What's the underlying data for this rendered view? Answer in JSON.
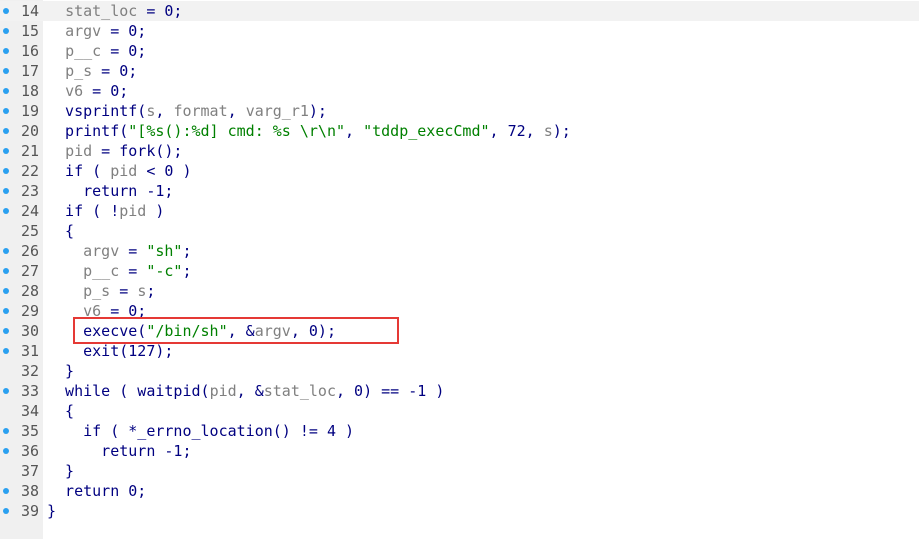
{
  "editor": {
    "accent_dot_color": "#2aa0f0",
    "highlight_color": "#e53935",
    "current_line": 14,
    "highlighted_line": 30
  },
  "lines": [
    {
      "num": "14",
      "dot": true,
      "tokens": [
        {
          "t": "  "
        },
        {
          "t": "stat_loc",
          "c": "var"
        },
        {
          "t": " = 0;"
        }
      ]
    },
    {
      "num": "15",
      "dot": true,
      "tokens": [
        {
          "t": "  "
        },
        {
          "t": "argv",
          "c": "var"
        },
        {
          "t": " = 0;"
        }
      ]
    },
    {
      "num": "16",
      "dot": true,
      "tokens": [
        {
          "t": "  "
        },
        {
          "t": "p__c",
          "c": "var"
        },
        {
          "t": " = 0;"
        }
      ]
    },
    {
      "num": "17",
      "dot": true,
      "tokens": [
        {
          "t": "  "
        },
        {
          "t": "p_s",
          "c": "var"
        },
        {
          "t": " = 0;"
        }
      ]
    },
    {
      "num": "18",
      "dot": true,
      "tokens": [
        {
          "t": "  "
        },
        {
          "t": "v6",
          "c": "var"
        },
        {
          "t": " = 0;"
        }
      ]
    },
    {
      "num": "19",
      "dot": true,
      "tokens": [
        {
          "t": "  vsprintf("
        },
        {
          "t": "s",
          "c": "var"
        },
        {
          "t": ", "
        },
        {
          "t": "format",
          "c": "var"
        },
        {
          "t": ", "
        },
        {
          "t": "varg_r1",
          "c": "var"
        },
        {
          "t": ");"
        }
      ]
    },
    {
      "num": "20",
      "dot": true,
      "tokens": [
        {
          "t": "  printf("
        },
        {
          "t": "\"[%s():%d] cmd: %s \\r\\n\"",
          "c": "str"
        },
        {
          "t": ", "
        },
        {
          "t": "\"tddp_execCmd\"",
          "c": "str"
        },
        {
          "t": ", 72, "
        },
        {
          "t": "s",
          "c": "var"
        },
        {
          "t": ");"
        }
      ]
    },
    {
      "num": "21",
      "dot": true,
      "tokens": [
        {
          "t": "  "
        },
        {
          "t": "pid",
          "c": "var"
        },
        {
          "t": " = fork();"
        }
      ]
    },
    {
      "num": "22",
      "dot": true,
      "tokens": [
        {
          "t": "  if ( "
        },
        {
          "t": "pid",
          "c": "var"
        },
        {
          "t": " < 0 )"
        }
      ]
    },
    {
      "num": "23",
      "dot": true,
      "tokens": [
        {
          "t": "    return -1;"
        }
      ]
    },
    {
      "num": "24",
      "dot": true,
      "tokens": [
        {
          "t": "  if ( !"
        },
        {
          "t": "pid",
          "c": "var"
        },
        {
          "t": " )"
        }
      ]
    },
    {
      "num": "25",
      "dot": false,
      "tokens": [
        {
          "t": "  {"
        }
      ]
    },
    {
      "num": "26",
      "dot": true,
      "tokens": [
        {
          "t": "    "
        },
        {
          "t": "argv",
          "c": "var"
        },
        {
          "t": " = "
        },
        {
          "t": "\"sh\"",
          "c": "str"
        },
        {
          "t": ";"
        }
      ]
    },
    {
      "num": "27",
      "dot": true,
      "tokens": [
        {
          "t": "    "
        },
        {
          "t": "p__c",
          "c": "var"
        },
        {
          "t": " = "
        },
        {
          "t": "\"-c\"",
          "c": "str"
        },
        {
          "t": ";"
        }
      ]
    },
    {
      "num": "28",
      "dot": true,
      "tokens": [
        {
          "t": "    "
        },
        {
          "t": "p_s",
          "c": "var"
        },
        {
          "t": " = "
        },
        {
          "t": "s",
          "c": "var"
        },
        {
          "t": ";"
        }
      ]
    },
    {
      "num": "29",
      "dot": true,
      "tokens": [
        {
          "t": "    "
        },
        {
          "t": "v6",
          "c": "var"
        },
        {
          "t": " = 0;"
        }
      ]
    },
    {
      "num": "30",
      "dot": true,
      "tokens": [
        {
          "t": "    execve("
        },
        {
          "t": "\"/bin/sh\"",
          "c": "str"
        },
        {
          "t": ", &"
        },
        {
          "t": "argv",
          "c": "var"
        },
        {
          "t": ", 0);"
        }
      ]
    },
    {
      "num": "31",
      "dot": true,
      "tokens": [
        {
          "t": "    exit(127);"
        }
      ]
    },
    {
      "num": "32",
      "dot": false,
      "tokens": [
        {
          "t": "  }"
        }
      ]
    },
    {
      "num": "33",
      "dot": true,
      "tokens": [
        {
          "t": "  while ( waitpid("
        },
        {
          "t": "pid",
          "c": "var"
        },
        {
          "t": ", &"
        },
        {
          "t": "stat_loc",
          "c": "var"
        },
        {
          "t": ", 0) == -1 )"
        }
      ]
    },
    {
      "num": "34",
      "dot": false,
      "tokens": [
        {
          "t": "  {"
        }
      ]
    },
    {
      "num": "35",
      "dot": true,
      "tokens": [
        {
          "t": "    if ( *_errno_location() != 4 )"
        }
      ]
    },
    {
      "num": "36",
      "dot": true,
      "tokens": [
        {
          "t": "      return -1;"
        }
      ]
    },
    {
      "num": "37",
      "dot": false,
      "tokens": [
        {
          "t": "  }"
        }
      ]
    },
    {
      "num": "38",
      "dot": true,
      "tokens": [
        {
          "t": "  return 0;"
        }
      ]
    },
    {
      "num": "39",
      "dot": true,
      "tokens": [
        {
          "t": "}"
        }
      ]
    }
  ]
}
